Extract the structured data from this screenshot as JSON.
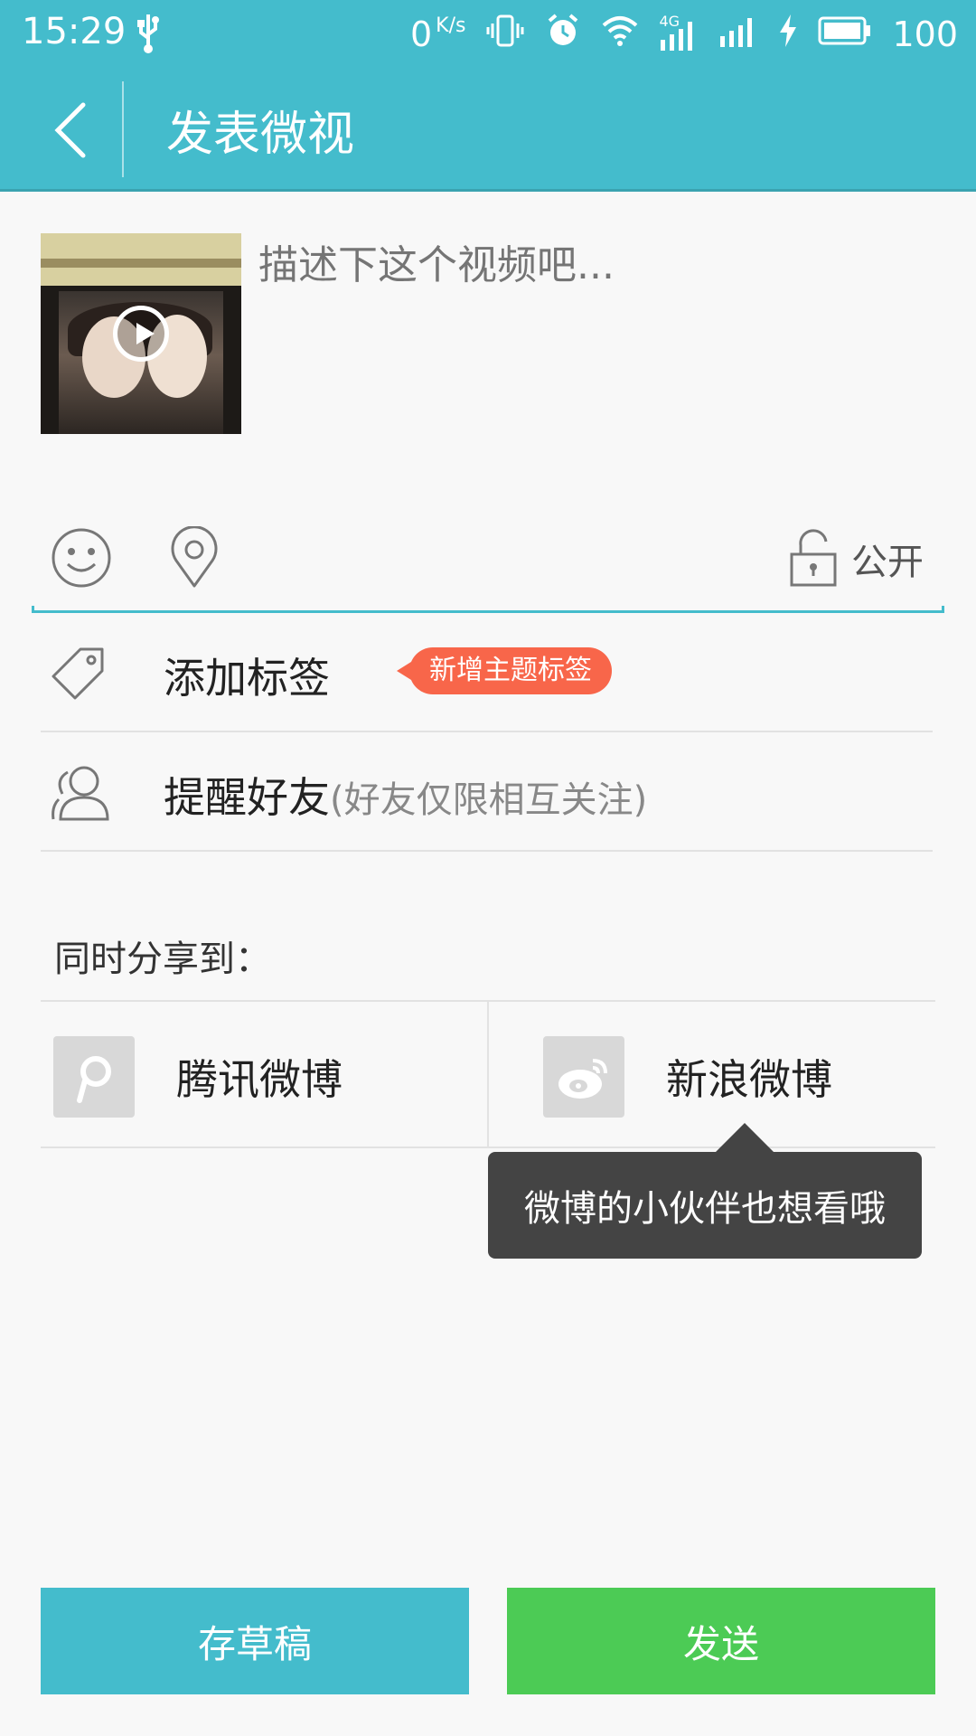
{
  "status_bar": {
    "time": "15:29",
    "speed_value": "0",
    "speed_unit": "K/s",
    "network": "4G",
    "battery": "100"
  },
  "header": {
    "title": "发表微视"
  },
  "composer": {
    "placeholder": "描述下这个视频吧..."
  },
  "toolbar": {
    "privacy_label": "公开"
  },
  "options": {
    "tag_label": "添加标签",
    "tag_badge": "新增主题标签",
    "mention_label": "提醒好友",
    "mention_hint": "(好友仅限相互关注)"
  },
  "share": {
    "title": "同时分享到：",
    "tencent_label": "腾讯微博",
    "sina_label": "新浪微博",
    "tooltip": "微博的小伙伴也想看哦"
  },
  "actions": {
    "draft_label": "存草稿",
    "send_label": "发送"
  },
  "colors": {
    "accent": "#44bccc",
    "send": "#4ccb55",
    "badge": "#f8664a"
  }
}
